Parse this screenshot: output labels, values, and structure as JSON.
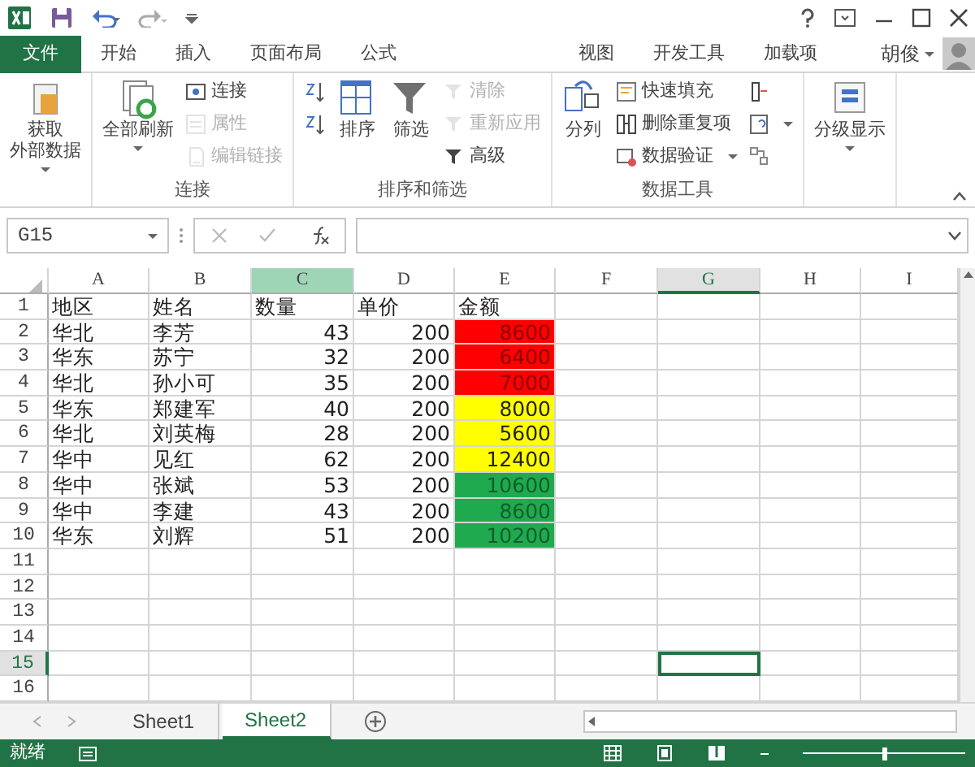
{
  "ribbon_tabs": [
    {
      "label": "文件",
      "kind": "file",
      "selected": false
    },
    {
      "label": "开始",
      "kind": "tab",
      "selected": false
    },
    {
      "label": "插入",
      "kind": "tab",
      "selected": false
    },
    {
      "label": "页面布局",
      "kind": "tab",
      "selected": false
    },
    {
      "label": "公式",
      "kind": "tab",
      "selected": false
    },
    {
      "label": "视图",
      "kind": "tab",
      "selected": false
    },
    {
      "label": "开发工具",
      "kind": "tab",
      "selected": false
    },
    {
      "label": "加载项",
      "kind": "tab",
      "selected": false
    }
  ],
  "user": {
    "name": "胡俊"
  },
  "ribbon_groups": [
    {
      "items": [
        {
          "kind": "large",
          "label": [
            "获取",
            "外部数据"
          ],
          "dropdown": true,
          "disabled": false
        }
      ]
    },
    {
      "label": "连接",
      "items": [
        {
          "kind": "large",
          "label": "全部刷新",
          "dropdown": true,
          "disabled": false
        },
        {
          "kind": "small",
          "label": "连接",
          "disabled": false
        },
        {
          "kind": "small",
          "label": "属性",
          "disabled": true
        },
        {
          "kind": "small",
          "label": "编辑链接",
          "disabled": true
        }
      ]
    },
    {
      "label": "排序和筛选",
      "items": [
        {
          "kind": "icon",
          "disabled": false
        },
        {
          "kind": "icon",
          "disabled": false
        },
        {
          "kind": "large",
          "label": "排序",
          "disabled": false
        },
        {
          "kind": "large",
          "label": "筛选",
          "disabled": false
        },
        {
          "kind": "small",
          "label": "清除",
          "disabled": true
        },
        {
          "kind": "small",
          "label": "重新应用",
          "disabled": true
        },
        {
          "kind": "small",
          "label": "高级",
          "disabled": false
        }
      ]
    },
    {
      "label": "数据工具",
      "items": [
        {
          "kind": "large",
          "label": "分列",
          "disabled": false
        },
        {
          "kind": "small",
          "label": "快速填充",
          "disabled": false
        },
        {
          "kind": "small",
          "label": "删除重复项",
          "disabled": false
        },
        {
          "kind": "small",
          "label": "数据验证",
          "dropdown": true,
          "disabled": false
        },
        {
          "kind": "icon",
          "disabled": false
        },
        {
          "kind": "icon",
          "dropdown": true,
          "disabled": false
        },
        {
          "kind": "icon",
          "disabled": false
        }
      ]
    },
    {
      "items": [
        {
          "kind": "large",
          "label": "分级显示",
          "dropdown": true,
          "disabled": false
        }
      ]
    }
  ],
  "name_box": "G15",
  "columns": [
    {
      "label": "A",
      "selected": false,
      "highlighted": false
    },
    {
      "label": "B",
      "selected": false,
      "highlighted": false
    },
    {
      "label": "C",
      "selected": false,
      "highlighted": true
    },
    {
      "label": "D",
      "selected": false,
      "highlighted": false
    },
    {
      "label": "E",
      "selected": false,
      "highlighted": false
    },
    {
      "label": "F",
      "selected": false,
      "highlighted": false
    },
    {
      "label": "G",
      "selected": true,
      "highlighted": false
    },
    {
      "label": "H",
      "selected": false,
      "highlighted": false
    },
    {
      "label": "I",
      "selected": false,
      "highlighted": false
    }
  ],
  "rows": [
    {
      "header": "1",
      "selected": false,
      "kind": "heading",
      "cells": [
        "地区",
        "姓名",
        "数量",
        "单价",
        "金额"
      ]
    },
    {
      "header": "2",
      "selected": false,
      "kind": "data",
      "cells": [
        "华北",
        "李芳",
        "43",
        "200",
        "8600"
      ],
      "color": "#ff0000"
    },
    {
      "header": "3",
      "selected": false,
      "kind": "data",
      "cells": [
        "华东",
        "苏宁",
        "32",
        "200",
        "6400"
      ],
      "color": "#ff0000"
    },
    {
      "header": "4",
      "selected": false,
      "kind": "data",
      "cells": [
        "华北",
        "孙小可",
        "35",
        "200",
        "7000"
      ],
      "color": "#ff0000"
    },
    {
      "header": "5",
      "selected": false,
      "kind": "data",
      "cells": [
        "华东",
        "郑建军",
        "40",
        "200",
        "8000"
      ],
      "color": "#ffff00"
    },
    {
      "header": "6",
      "selected": false,
      "kind": "data",
      "cells": [
        "华北",
        "刘英梅",
        "28",
        "200",
        "5600"
      ],
      "color": "#ffff00"
    },
    {
      "header": "7",
      "selected": false,
      "kind": "data",
      "cells": [
        "华中",
        "见红",
        "62",
        "200",
        "12400"
      ],
      "color": "#ffff00"
    },
    {
      "header": "8",
      "selected": false,
      "kind": "data",
      "cells": [
        "华中",
        "张斌",
        "53",
        "200",
        "10600"
      ],
      "color": "#1faa4f"
    },
    {
      "header": "9",
      "selected": false,
      "kind": "data",
      "cells": [
        "华中",
        "李建",
        "43",
        "200",
        "8600"
      ],
      "color": "#1faa4f"
    },
    {
      "header": "10",
      "selected": false,
      "kind": "data",
      "cells": [
        "华东",
        "刘辉",
        "51",
        "200",
        "10200"
      ],
      "color": "#1faa4f"
    },
    {
      "header": "11",
      "selected": false,
      "kind": "empty"
    },
    {
      "header": "12",
      "selected": false,
      "kind": "empty"
    },
    {
      "header": "13",
      "selected": false,
      "kind": "empty"
    },
    {
      "header": "14",
      "selected": false,
      "kind": "empty"
    },
    {
      "header": "15",
      "selected": true,
      "kind": "empty"
    },
    {
      "header": "16",
      "selected": false,
      "kind": "empty"
    }
  ],
  "sheets": [
    {
      "label": "Sheet1",
      "selected": false
    },
    {
      "label": "Sheet2",
      "selected": true
    }
  ],
  "status_bar": {
    "text": "就绪"
  },
  "zoom": {
    "level": 0.5
  }
}
